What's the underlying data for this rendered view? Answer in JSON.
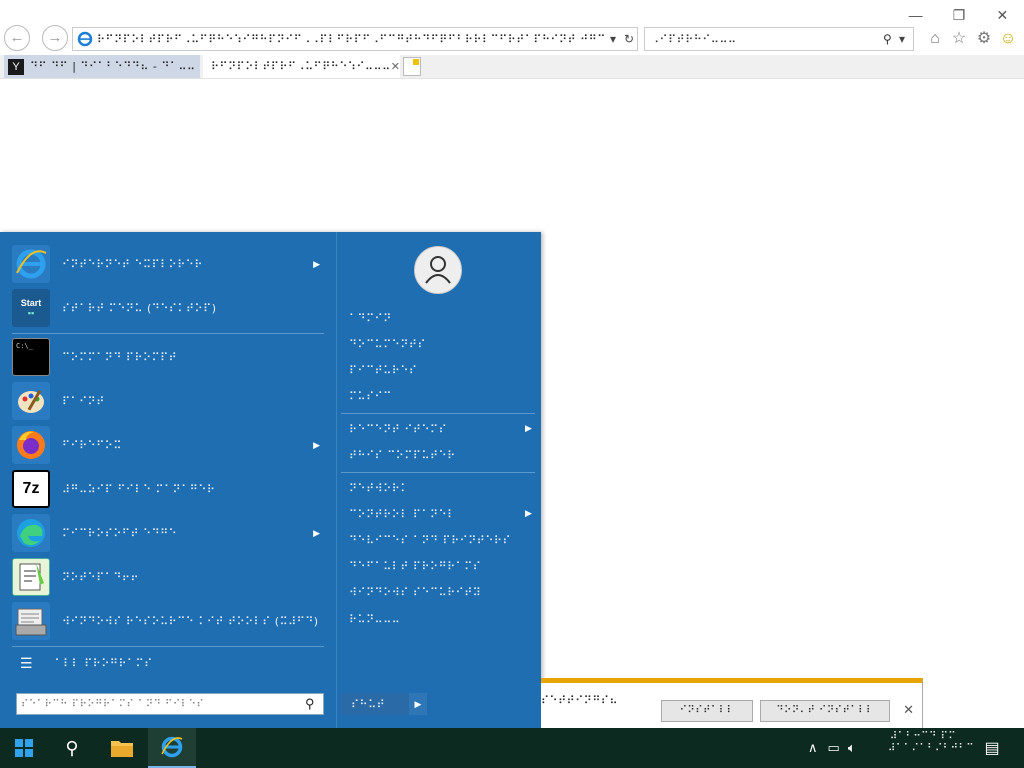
{
  "browser": {
    "address_url": "⠗⠋⠝⠏⠕⠇⠞⠏⠗⠋⠠⠥⠋⠟⠓⠑⠱⠊⠛⠓⠏⠝⠊⠋⠠⠠⠏⠇⠋⠗⠏⠋⠠⠋⠉⠛⠞⠓⠙⠋⠟⠋⠃⠗⠗⠇⠉⠋⠗⠞⠁⠏⠓⠊⠝⠞ ⠚⠛⠉ ⠙ ⠙ ⠙&⠙⠞⠏",
    "search_placeholder": "⠠⠊⠏⠞⠗⠓⠊⠤⠤⠤",
    "tabs": [
      {
        "label": "⠙⠋ ⠙⠋ | ⠙⠊⠁⠃⠑⠙⠙⠦ - ⠙⠁⠤⠤"
      },
      {
        "label": "⠗⠋⠝⠏⠕⠇⠞⠏⠗⠋⠠⠥⠋⠟⠓⠑⠱⠊⠤⠤⠤"
      }
    ],
    "controls": {
      "minimize": "—",
      "restore": "❐",
      "close": "✕"
    }
  },
  "start_menu": {
    "programs": [
      {
        "label": "⠊⠝⠞⠑⠗⠝⠑⠞ ⠑⠭⠏⠇⠕⠗⠑⠗",
        "icon": "internet-explorer-icon",
        "submenu": true
      },
      {
        "label": "⠎⠞⠁⠗⠞ ⠍⠑⠝⠥ (⠙⠑⠎⠅⠞⠕⠏)",
        "icon": "start-menu-icon",
        "submenu": false
      },
      {
        "label": "⠉⠕⠍⠍⠁⠝⠙ ⠏⠗⠕⠍⠏⠞",
        "icon": "command-prompt-icon",
        "submenu": false
      },
      {
        "label": "⠏⠁⠊⠝⠞",
        "icon": "paint-icon",
        "submenu": false
      },
      {
        "label": "⠋⠊⠗⠑⠋⠕⠭",
        "icon": "firefox-icon",
        "submenu": true
      },
      {
        "label": "⠼⠛⠤⠵⠊⠏ ⠋⠊⠇⠑ ⠍⠁⠝⠁⠛⠑⠗",
        "icon": "7zip-icon",
        "submenu": false
      },
      {
        "label": "⠍⠊⠉⠗⠕⠎⠕⠋⠞ ⠑⠙⠛⠑",
        "icon": "edge-icon",
        "submenu": true
      },
      {
        "label": "⠝⠕⠞⠑⠏⠁⠙⠖⠖",
        "icon": "notepad-plus-icon",
        "submenu": false
      },
      {
        "label": "⠺⠊⠝⠙⠕⠺⠎ ⠗⠑⠎⠕⠥⠗⠉⠑ ⠅⠊⠞ ⠞⠕⠕⠇⠎ (⠭⠼⠋⠙)",
        "icon": "resource-kit-icon",
        "submenu": false
      }
    ],
    "all_programs": "⠁⠇⠇ ⠏⠗⠕⠛⠗⠁⠍⠎",
    "search_placeholder": "⠎⠑⠁⠗⠉⠓ ⠏⠗⠕⠛⠗⠁⠍⠎ ⠁⠝⠙ ⠋⠊⠇⠑⠎",
    "right_group1": [
      "⠁⠙⠍⠊⠝",
      "⠙⠕⠉⠥⠍⠑⠝⠞⠎",
      "⠏⠊⠉⠞⠥⠗⠑⠎",
      "⠍⠥⠎⠊⠉"
    ],
    "right_group2": [
      {
        "label": "⠗⠑⠉⠑⠝⠞ ⠊⠞⠑⠍⠎",
        "submenu": true
      },
      {
        "label": "⠞⠓⠊⠎ ⠉⠕⠍⠏⠥⠞⠑⠗",
        "submenu": false
      }
    ],
    "right_group3": [
      {
        "label": "⠝⠑⠞⠺⠕⠗⠅",
        "submenu": false
      },
      {
        "label": "⠉⠕⠝⠞⠗⠕⠇ ⠏⠁⠝⠑⠇",
        "submenu": true
      },
      {
        "label": "⠙⠑⠧⠊⠉⠑⠎ ⠁⠝⠙ ⠏⠗⠊⠝⠞⠑⠗⠎",
        "submenu": false
      },
      {
        "label": "⠙⠑⠋⠁⠥⠇⠞ ⠏⠗⠕⠛⠗⠁⠍⠎",
        "submenu": false
      },
      {
        "label": "⠺⠊⠝⠙⠕⠺⠎ ⠎⠑⠉⠥⠗⠊⠞⠽",
        "submenu": false
      },
      {
        "label": "⠗⠥⠝⠤⠤⠤",
        "submenu": false
      }
    ],
    "shutdown_label": "⠎⠓⠥⠞"
  },
  "notification": {
    "message": "⠎⠑⠞⠞⠊⠝⠛⠎⠦",
    "button1": "⠊⠝⠎⠞⠁⠇⠇",
    "button2": "⠙⠕⠝⠄⠞ ⠊⠝⠎⠞⠁⠇⠇"
  },
  "taskbar": {
    "clock_time": "⠼⠁⠃⠒⠉⠙ ⠏⠍",
    "clock_date": "⠼⠁⠁⠌⠁⠃⠌⠃⠚⠃⠉"
  },
  "colors": {
    "start_menu_bg": "#1f6eb1",
    "taskbar_bg": "#0c2a1f",
    "notification_accent": "#e8a400"
  }
}
